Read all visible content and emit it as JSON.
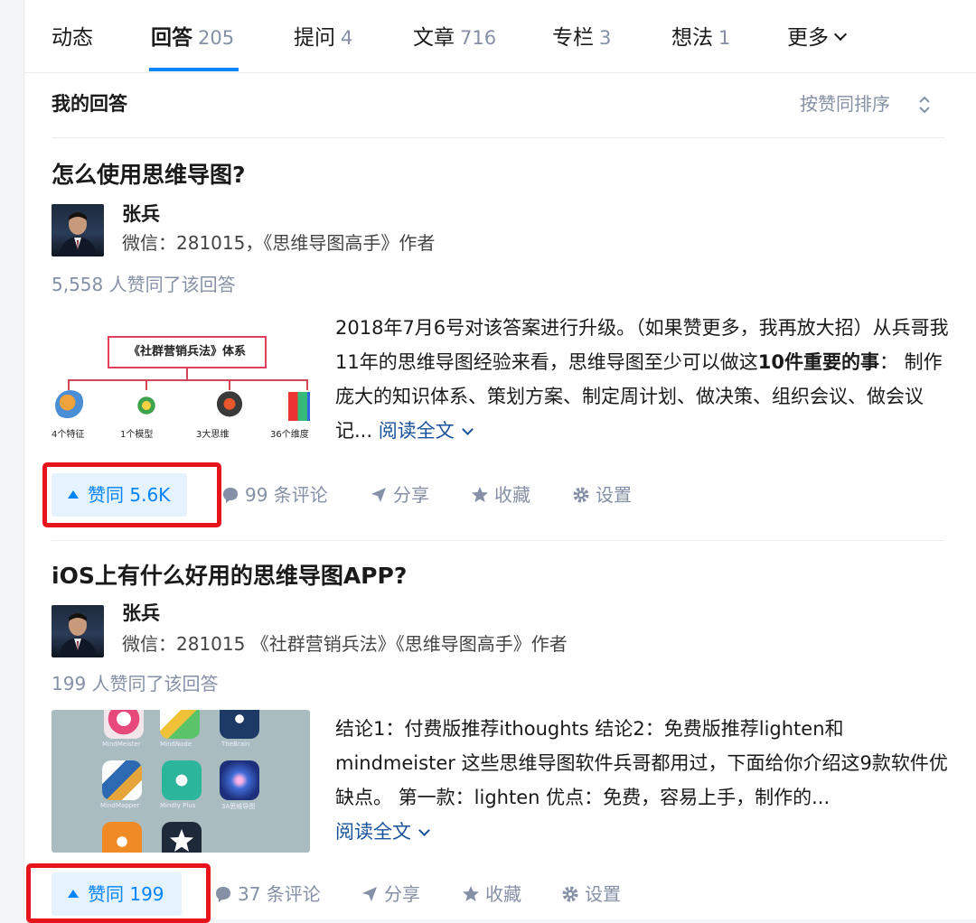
{
  "tabs": [
    {
      "label": "动态",
      "count": ""
    },
    {
      "label": "回答",
      "count": "205"
    },
    {
      "label": "提问",
      "count": "4"
    },
    {
      "label": "文章",
      "count": "716"
    },
    {
      "label": "专栏",
      "count": "3"
    },
    {
      "label": "想法",
      "count": "1"
    },
    {
      "label": "更多",
      "count": ""
    }
  ],
  "active_tab": "回答",
  "section": {
    "title": "我的回答",
    "sort_label": "按赞同排序"
  },
  "answers": [
    {
      "question": "怎么使用思维导图?",
      "author_name": "张兵",
      "author_desc": "微信：281015，《思维导图高手》作者",
      "votes_line": "5,558 人赞同了该回答",
      "excerpt_p1": "2018年7月6号对该答案进行升级。（如果赞更多，我再放大招）从兵哥我11年的思维导图经验来看，思维导图至少可以做这",
      "excerpt_bold": "10件重要的事",
      "excerpt_p2": "： 制作庞大的知识体系、策划方案、制定周计划、做决策、组织会议、做会议记...",
      "read_more": "阅读全文",
      "thumb": {
        "title": "《社群营销兵法》体系",
        "labels": [
          "4个特征",
          "1个模型",
          "3大思维",
          "36个维度"
        ]
      },
      "vote_label": "赞同 5.6K",
      "comment_label": "99 条评论",
      "share_label": "分享",
      "favorite_label": "收藏",
      "settings_label": "设置"
    },
    {
      "question": "iOS上有什么好用的思维导图APP?",
      "author_name": "张兵",
      "author_desc": "微信：281015 《社群营销兵法》《思维导图高手》作者",
      "votes_line": "199 人赞同了该回答",
      "excerpt_p1": "结论1：付费版推荐ithoughts 结论2：免费版推荐lighten和mindmeister 这些思维导图软件兵哥都用过，下面给你介绍这9款软件优缺点。 第一款：lighten 优点：免费，容易上手，制作的...",
      "excerpt_bold": "",
      "excerpt_p2": "",
      "read_more": "阅读全文",
      "thumb": {
        "labels": [
          "MindMeister",
          "MindNode",
          "TheBrain",
          "MindMapper",
          "Mindly Plus",
          "3A思维导图"
        ]
      },
      "vote_label": "赞同 199",
      "comment_label": "37 条评论",
      "share_label": "分享",
      "favorite_label": "收藏",
      "settings_label": "设置"
    }
  ],
  "colors": {
    "accent": "#0084ff",
    "highlight": "#e8141c",
    "muted": "#8590a6",
    "link": "#175199"
  }
}
